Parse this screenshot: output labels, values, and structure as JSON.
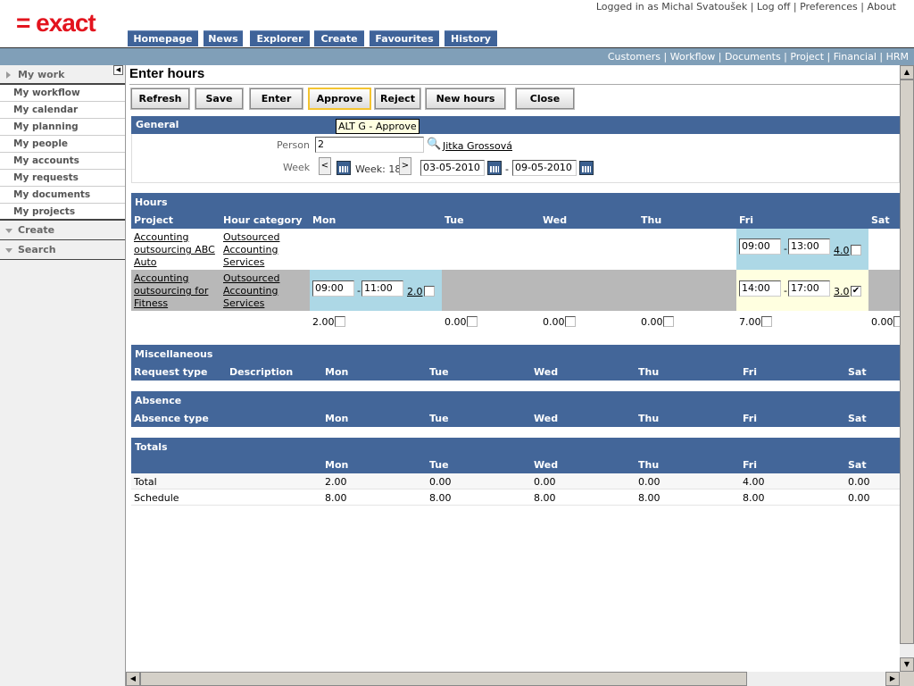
{
  "header": {
    "logo": "= exact",
    "user_text": "Logged in as Michal Svatoušek",
    "links": [
      "Log off",
      "Preferences",
      "About"
    ],
    "tabs": [
      "Homepage",
      "News",
      "Explorer",
      "Create",
      "Favourites",
      "History"
    ],
    "sub_links": [
      "Customers",
      "Workflow",
      "Documents",
      "Project",
      "Financial",
      "HRM"
    ]
  },
  "sidebar": {
    "my_work": "My work",
    "items": [
      "My workflow",
      "My calendar",
      "My planning",
      "My people",
      "My accounts",
      "My requests",
      "My documents",
      "My projects"
    ],
    "create": "Create",
    "search": "Search"
  },
  "page": {
    "title": "Enter hours"
  },
  "toolbar": [
    "Refresh",
    "Save",
    "Enter",
    "Approve",
    "Reject",
    "New hours",
    "Close"
  ],
  "tooltip": "ALT G - Approve",
  "general": {
    "title": "General",
    "person_label": "Person",
    "person_value": "2",
    "person_name": "Jitka Grossová",
    "week_label": "Week",
    "prev": "<",
    "next": ">",
    "week_text": "Week: 18",
    "date_from": "03-05-2010",
    "date_to": "09-05-2010",
    "dash": "-"
  },
  "hours": {
    "title": "Hours",
    "columns": [
      "Project",
      "Hour category",
      "Mon",
      "Tue",
      "Wed",
      "Thu",
      "Fri",
      "Sat"
    ],
    "rows": [
      {
        "project": [
          "Accounting",
          "outsourcing ABC",
          "Auto"
        ],
        "category": [
          "Outsourced",
          "Accounting",
          "Services"
        ],
        "fri": {
          "from": "09:00",
          "to": "13:00",
          "hours": "4.0",
          "checked": false
        }
      },
      {
        "project": [
          "Accounting",
          "outsourcing for",
          "Fitness"
        ],
        "category": [
          "Outsourced",
          "Accounting",
          "Services"
        ],
        "mon": {
          "from": "09:00",
          "to": "11:00",
          "hours": "2.0",
          "checked": false
        },
        "fri": {
          "from": "14:00",
          "to": "17:00",
          "hours": "3.0",
          "checked": true
        }
      }
    ],
    "totals": [
      "2.00",
      "0.00",
      "0.00",
      "0.00",
      "7.00",
      "0.00"
    ]
  },
  "misc": {
    "title": "Miscellaneous",
    "columns": [
      "Request type",
      "Description",
      "Mon",
      "Tue",
      "Wed",
      "Thu",
      "Fri",
      "Sat"
    ]
  },
  "absence": {
    "title": "Absence",
    "columns": [
      "Absence type",
      "Mon",
      "Tue",
      "Wed",
      "Thu",
      "Fri",
      "Sat"
    ]
  },
  "totals": {
    "title": "Totals",
    "columns": [
      "Mon",
      "Tue",
      "Wed",
      "Thu",
      "Fri",
      "Sat"
    ],
    "rows": [
      {
        "label": "Total",
        "values": [
          "2.00",
          "0.00",
          "0.00",
          "0.00",
          "4.00",
          "0.00"
        ]
      },
      {
        "label": "Schedule",
        "values": [
          "8.00",
          "8.00",
          "8.00",
          "8.00",
          "8.00",
          "0.00"
        ]
      }
    ]
  },
  "colors": {
    "accent": "#436699",
    "logo": "#e3141e",
    "cell_blue": "#add8e6",
    "cell_yellow": "#ffffe0",
    "row_gray": "#b8b8b8"
  }
}
